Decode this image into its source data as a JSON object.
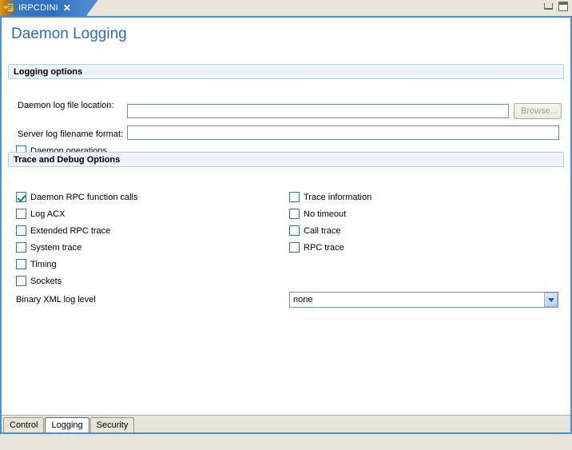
{
  "window": {
    "tab": {
      "label": "IRPCDINI",
      "icon": "ini-file-icon",
      "close_icon": "close-icon"
    },
    "controls": {
      "minimize": "minimize-button",
      "maximize": "maximize-button"
    }
  },
  "page": {
    "title": "Daemon Logging",
    "title_color": "#2f6cb5"
  },
  "logging_options": {
    "header": "Logging options",
    "fields": [
      {
        "label": "Daemon log file location:",
        "value": "",
        "placeholder": ""
      },
      {
        "label": "Server log filename format:",
        "value": "",
        "placeholder": ""
      }
    ],
    "browse_button": {
      "label": "Browse...",
      "disabled": true
    },
    "checkbox": {
      "label": "Daemon operations",
      "checked": false
    }
  },
  "trace_debug_options": {
    "header": "Trace and Debug Options",
    "left_checkboxes": [
      {
        "label": "Daemon RPC function calls",
        "checked": true
      },
      {
        "label": "Log ACX",
        "checked": false
      },
      {
        "label": "Extended RPC trace",
        "checked": false
      },
      {
        "label": "System trace",
        "checked": false
      },
      {
        "label": "Timing",
        "checked": false
      },
      {
        "label": "Sockets",
        "checked": false
      }
    ],
    "right_checkboxes": [
      {
        "label": "Trace information",
        "checked": false
      },
      {
        "label": "No timeout",
        "checked": false
      },
      {
        "label": "Call trace",
        "checked": false
      },
      {
        "label": "RPC trace",
        "checked": false
      }
    ],
    "binary_xml": {
      "label": "Binary XML log level",
      "selected": "none"
    }
  },
  "bottom_tabs": [
    {
      "label": "Control",
      "active": false
    },
    {
      "label": "Logging",
      "active": true
    },
    {
      "label": "Security",
      "active": false
    }
  ]
}
